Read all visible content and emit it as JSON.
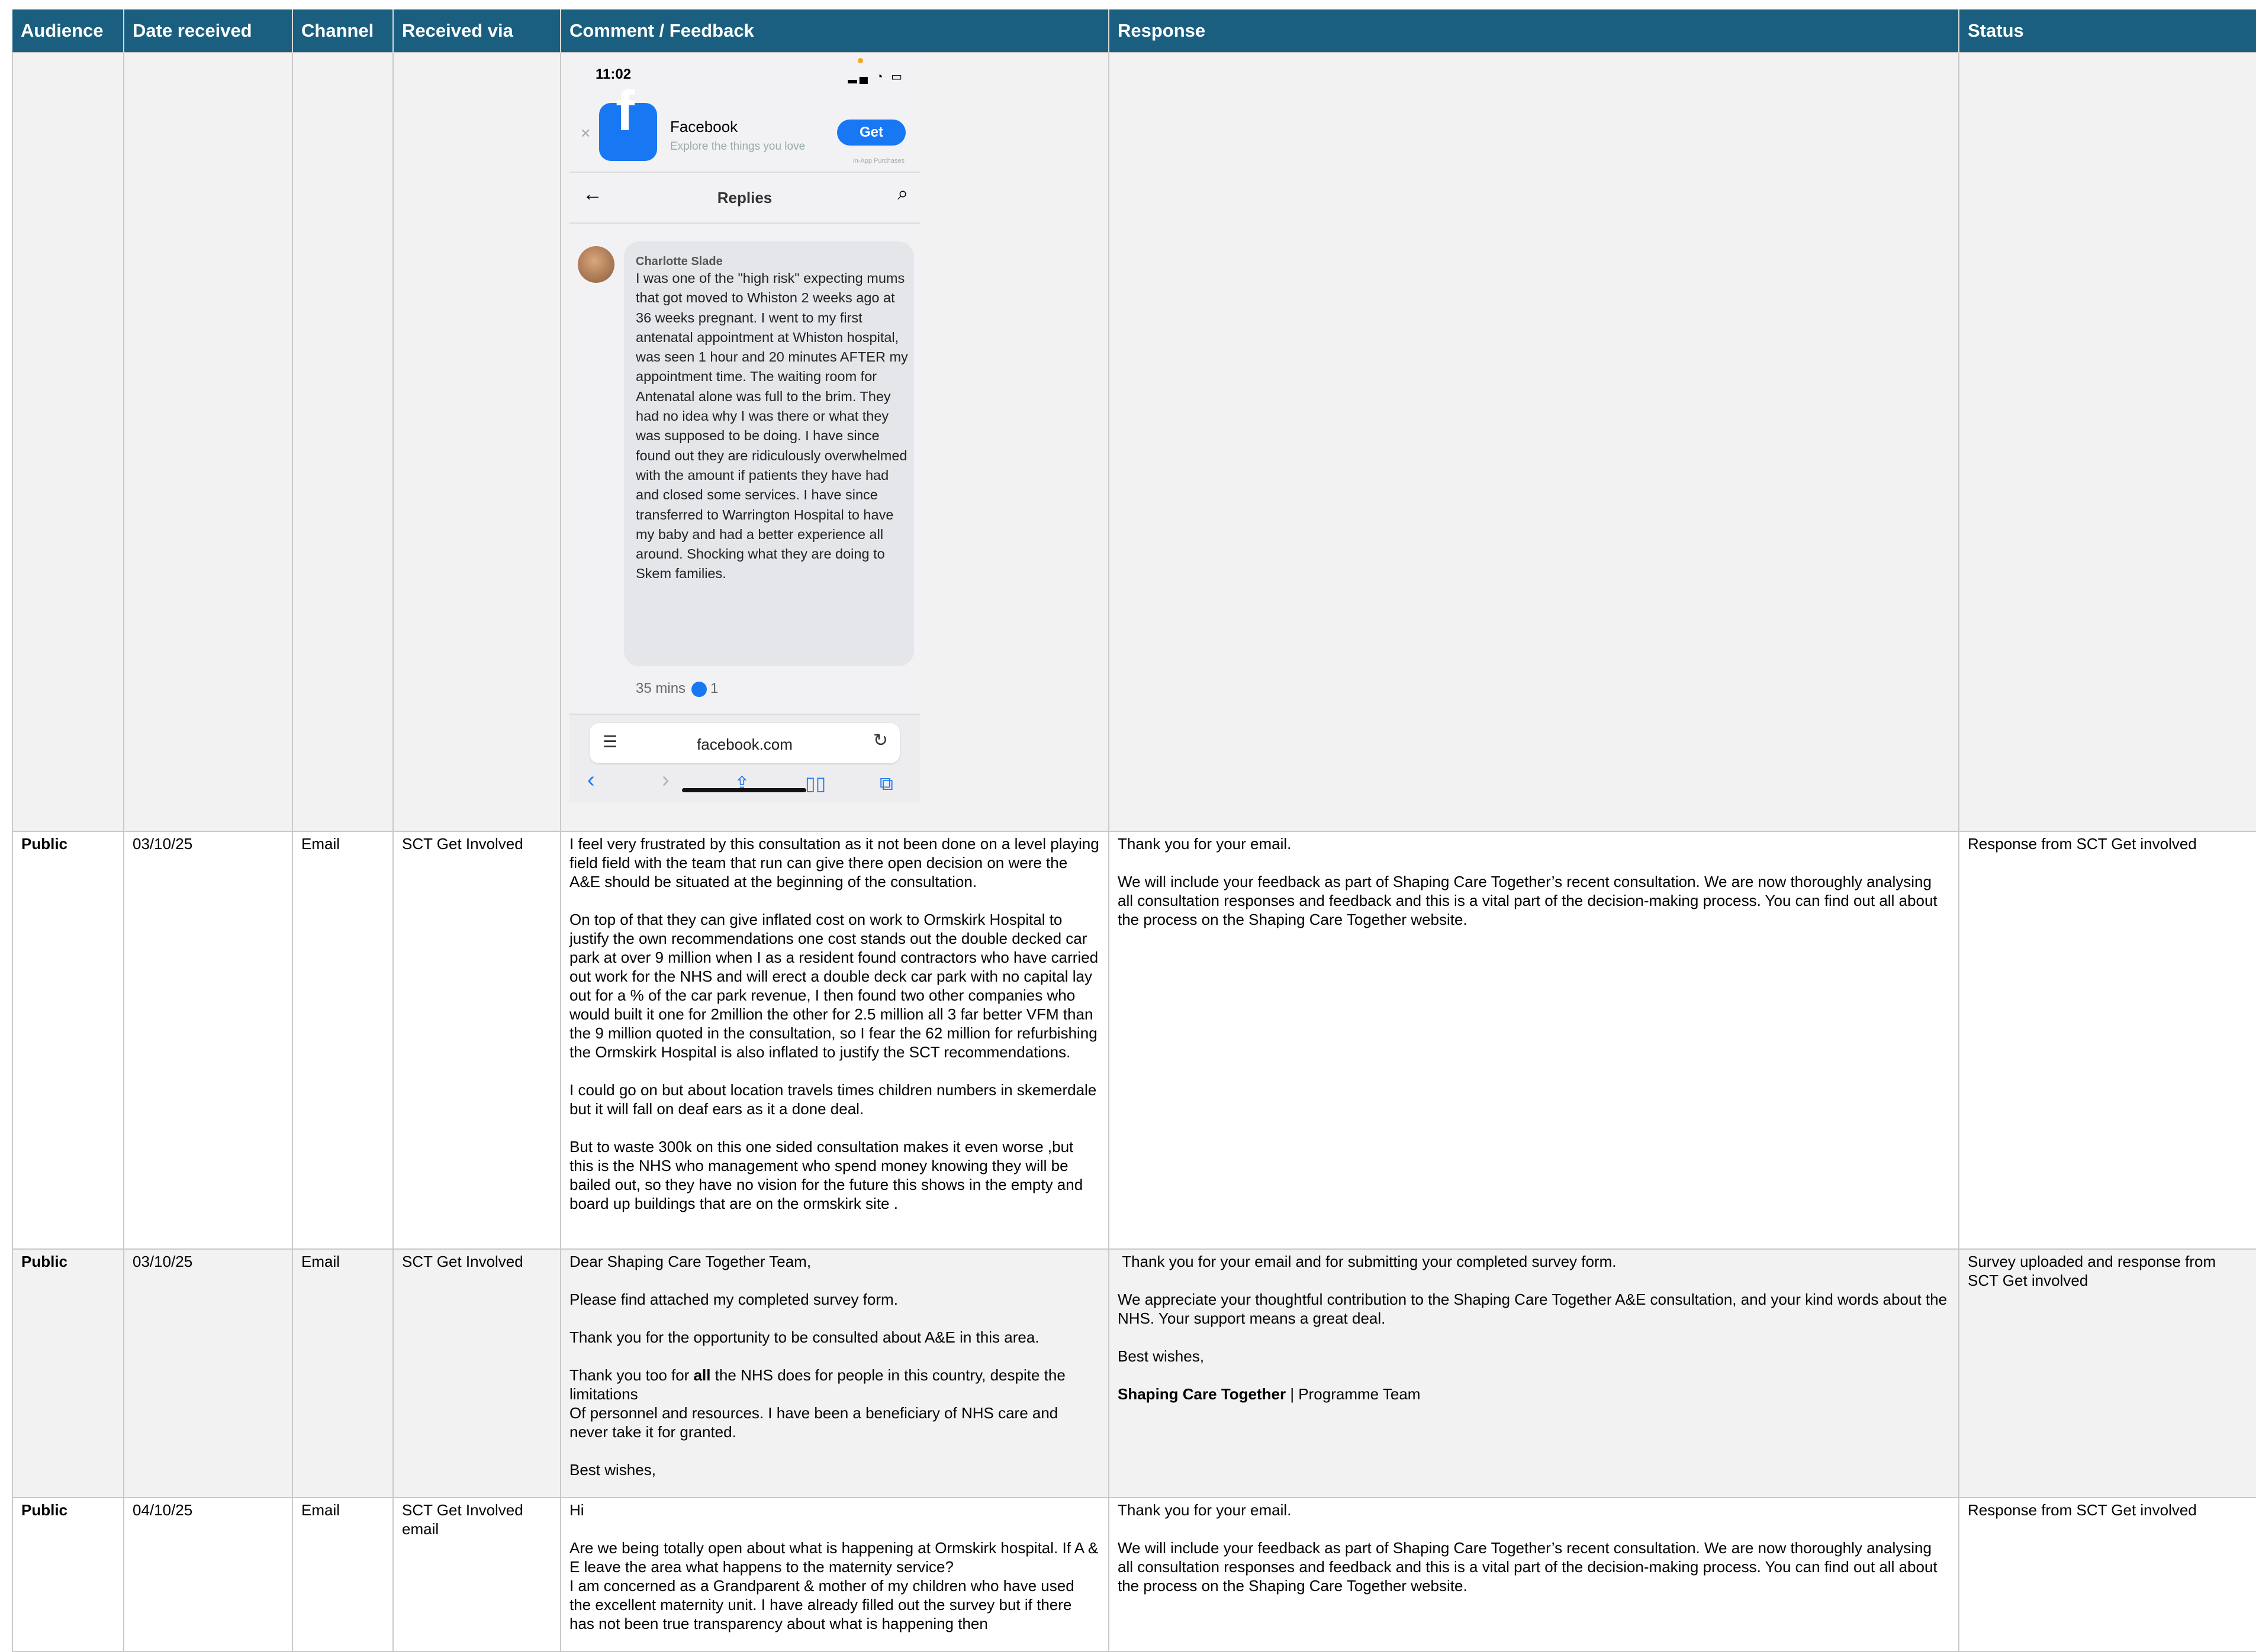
{
  "headers": {
    "audience": "Audience",
    "date": "Date received",
    "channel": "Channel",
    "via": "Received via",
    "comment": "Comment / Feedback",
    "response": "Response",
    "status": "Status"
  },
  "phone": {
    "time": "11:02",
    "app_name": "Facebook",
    "app_tagline": "Explore the things you love",
    "get_label": "Get",
    "iap_label": "In-App Purchases",
    "nav_title": "Replies",
    "author": "Charlotte Slade",
    "comment": "I was one of the \"high risk\" expecting mums that got moved to Whiston 2 weeks ago at 36 weeks pregnant. I went to my first antenatal appointment at Whiston hospital, was seen 1 hour and 20 minutes AFTER my appointment time. The waiting room for Antenatal alone was full to the brim. They had no idea why I was there or what they was supposed to be doing. I have since found out they are ridiculously overwhelmed with the amount if patients they have had and closed some services. I have since transferred to Warrington Hospital to have my baby and had a better experience all around. Shocking what they are doing to Skem families.",
    "time_ago": "35 mins",
    "likes": "1",
    "url": "facebook.com"
  },
  "rows": [
    {
      "audience": "Public",
      "date": "03/10/25",
      "channel": "Email",
      "via": "SCT Get Involved",
      "comment": [
        "I feel very frustrated by this consultation as it not been done on a level playing field field with the team that run can give there open decision on were the A&E should be situated at the beginning of the consultation.",
        "On top of that they can give inflated cost on work to Ormskirk Hospital to justify the own recommendations one cost stands out the double decked car park at over 9 million when I as a resident found contractors who have carried out work for the NHS and will erect a double deck car park with no capital lay out for a % of the car park revenue, I then found two other companies who would built it one for 2million the other for 2.5 million all 3 far better VFM than the 9 million quoted in the consultation, so I fear the 62 million for refurbishing the Ormskirk Hospital is also inflated to justify the SCT recommendations.",
        "I could go on but about location travels times children numbers in skemerdale but it will fall on deaf ears as it a done deal.",
        "But to waste 300k on this one sided consultation makes it even worse ,but this is the NHS who management who spend money knowing they will be bailed out, so they have no vision for the future this shows in the empty and board up buildings that are on the ormskirk site ."
      ],
      "response": [
        "Thank you for your email.",
        "We will include your feedback as part of Shaping Care Together’s recent consultation. We are now thoroughly analysing all consultation responses and feedback and this is a vital part of the decision-making process. You can find out all about the process on the Shaping Care Together website."
      ],
      "status": "Response from SCT Get involved"
    },
    {
      "audience": "Public",
      "date": "03/10/25",
      "channel": "Email",
      "via": "SCT Get Involved",
      "comment": [
        "Dear Shaping Care Together Team,",
        "Please find attached my completed survey form.",
        "Thank you for the opportunity to be consulted about A&E in this area.",
        "Best wishes,"
      ],
      "comment_thanks_pre": "Thank you too for ",
      "comment_thanks_bold": "all",
      "comment_thanks_post": " the NHS does for people in this country, despite the limitations\nOf personnel and resources. I have been a beneficiary of NHS care and never take it for granted.",
      "response": [
        " Thank you for your email and for submitting your completed survey form.",
        "We appreciate your thoughtful contribution to the Shaping Care Together A&E consultation, and your kind words about the NHS. Your support means a great deal.",
        "Best wishes,"
      ],
      "response_sig_bold": "Shaping Care Together",
      "response_sig_rest": " | Programme Team",
      "status": "Survey uploaded and response from SCT Get involved"
    },
    {
      "audience": "Public",
      "date": "04/10/25",
      "channel": "Email",
      "via": "SCT Get Involved email",
      "comment": [
        "Hi",
        "Are we being totally open about what is happening at Ormskirk hospital. If A & E leave the area what happens to the maternity service?\nI am concerned as a Grandparent & mother of my children who have used the excellent maternity unit. I have already filled out the survey but if there has not been true transparency about what is happening then"
      ],
      "response": [
        "Thank you for your email.",
        "We will include your feedback as part of Shaping Care Together’s recent consultation. We are now thoroughly analysing all consultation responses and feedback and this is a vital part of the decision-making process. You can find out all about the process on the Shaping Care Together website."
      ],
      "status": "Response from SCT Get involved"
    }
  ]
}
